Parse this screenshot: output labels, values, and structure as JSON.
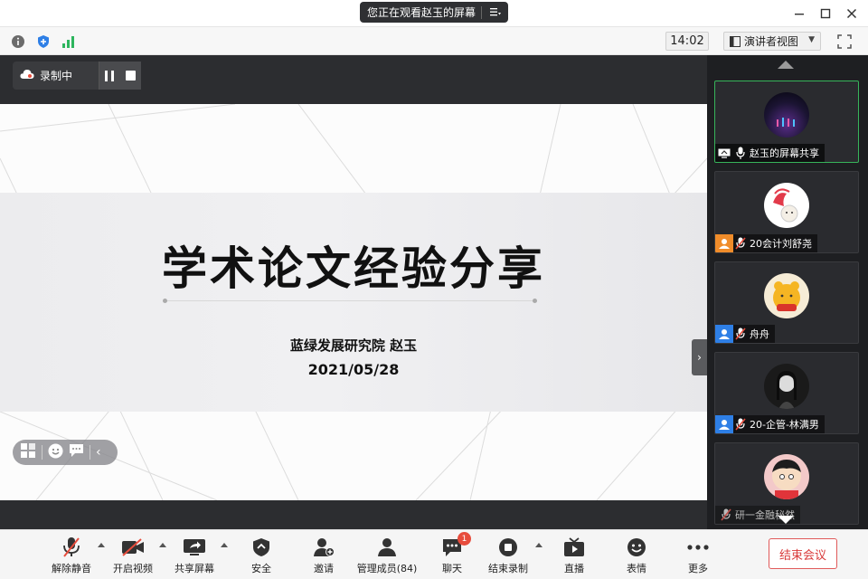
{
  "titlebar": {
    "share_notice": "您正在观看赵玉的屏幕"
  },
  "subbar": {
    "time": "14:02",
    "view_mode": "演讲者视图"
  },
  "recording": {
    "status": "录制中"
  },
  "slide": {
    "title": "学术论文经验分享",
    "author": "蓝绿发展研究院 赵玉",
    "date": "2021/05/28"
  },
  "participants": [
    {
      "name": "赵玉的屏幕共享",
      "role": "screen-share"
    },
    {
      "name": "20会计刘舒尧",
      "role": "member"
    },
    {
      "name": "舟舟",
      "role": "member"
    },
    {
      "name": "20-企管-林满男",
      "role": "member"
    },
    {
      "name": "研一金融秘然",
      "role": "member"
    }
  ],
  "toolbar": {
    "unmute": "解除静音",
    "start_video": "开启视频",
    "share_screen": "共享屏幕",
    "security": "安全",
    "invite": "邀请",
    "manage_members": "管理成员(84)",
    "chat": "聊天",
    "chat_badge": "1",
    "stop_recording": "结束录制",
    "live": "直播",
    "reactions": "表情",
    "more": "更多",
    "end_meeting": "结束会议"
  },
  "colors": {
    "accent_green": "#37b45a",
    "end_red": "#d93a3a",
    "badge_red": "#e74c3c"
  }
}
